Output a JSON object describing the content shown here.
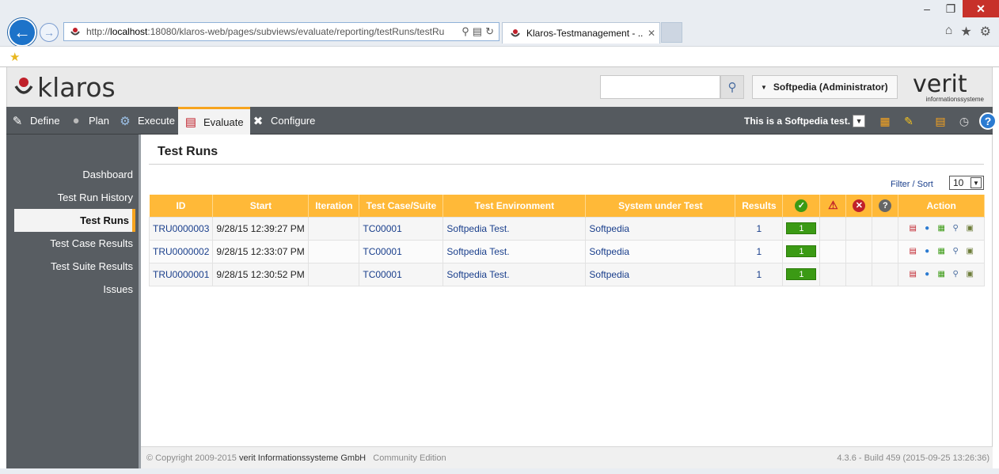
{
  "browser": {
    "url_prefix": "http://",
    "url_host": "localhost",
    "url_rest": ":18080/klaros-web/pages/subviews/evaluate/reporting/testRuns/testRu",
    "tab_title": "Klaros-Testmanagement - ..."
  },
  "header": {
    "logo_text": "klaros",
    "user_label": "Softpedia (Administrator)",
    "verit_logo": "verit",
    "verit_sub": "informationssysteme"
  },
  "nav": {
    "define": "Define",
    "plan": "Plan",
    "execute": "Execute",
    "evaluate": "Evaluate",
    "configure": "Configure",
    "project": "This is a Softpedia test."
  },
  "sidebar": {
    "items": [
      "Dashboard",
      "Test Run History",
      "Test Runs",
      "Test Case Results",
      "Test Suite Results",
      "Issues"
    ]
  },
  "main": {
    "title": "Test Runs",
    "filter_link": "Filter / Sort",
    "page_size": "10",
    "columns": [
      "ID",
      "Start",
      "Iteration",
      "Test Case/Suite",
      "Test Environment",
      "System under Test",
      "Results",
      "",
      "",
      "",
      "",
      "Action"
    ],
    "rows": [
      {
        "id": "TRU0000003",
        "start": "9/28/15 12:39:27 PM",
        "iteration": "",
        "tc": "TC00001",
        "env": "Softpedia Test.",
        "sut": "Softpedia",
        "results": "1",
        "passed": "1"
      },
      {
        "id": "TRU0000002",
        "start": "9/28/15 12:33:07 PM",
        "iteration": "",
        "tc": "TC00001",
        "env": "Softpedia Test.",
        "sut": "Softpedia",
        "results": "1",
        "passed": "1"
      },
      {
        "id": "TRU0000001",
        "start": "9/28/15 12:30:52 PM",
        "iteration": "",
        "tc": "TC00001",
        "env": "Softpedia Test.",
        "sut": "Softpedia",
        "results": "1",
        "passed": "1"
      }
    ]
  },
  "footer": {
    "copy_prefix": "© Copyright 2009-2015",
    "company": "verit Informationssysteme GmbH",
    "edition": "Community Edition",
    "build": "4.3.6 - Build 459 (2015-09-25 13:26:36)"
  },
  "colors": {
    "accent": "#ffb938",
    "nav": "#555a5f",
    "link": "#1a3f8c",
    "pass": "#3b9a14"
  }
}
